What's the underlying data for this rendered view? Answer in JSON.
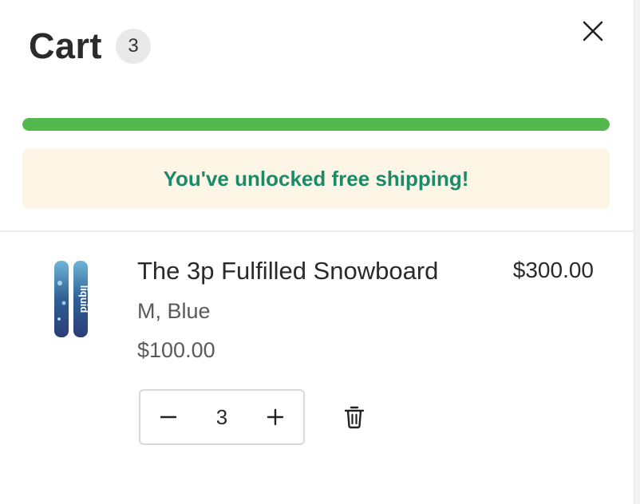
{
  "cart": {
    "title": "Cart",
    "count": "3"
  },
  "shipping": {
    "progress_percent": 100,
    "message": "You've unlocked free shipping!",
    "accent_color": "#53b84d",
    "message_color": "#1a8a68"
  },
  "items": [
    {
      "title": "The 3p Fulfilled Snowboard",
      "variant": "M,  Blue",
      "unit_price": "$100.00",
      "line_price": "$300.00",
      "quantity": "3",
      "thumbnail_icon": "snowboard-image",
      "thumbnail_text": "liquid"
    }
  ],
  "icons": {
    "close": "close-icon",
    "decrease": "minus-icon",
    "increase": "plus-icon",
    "remove": "trash-icon"
  }
}
